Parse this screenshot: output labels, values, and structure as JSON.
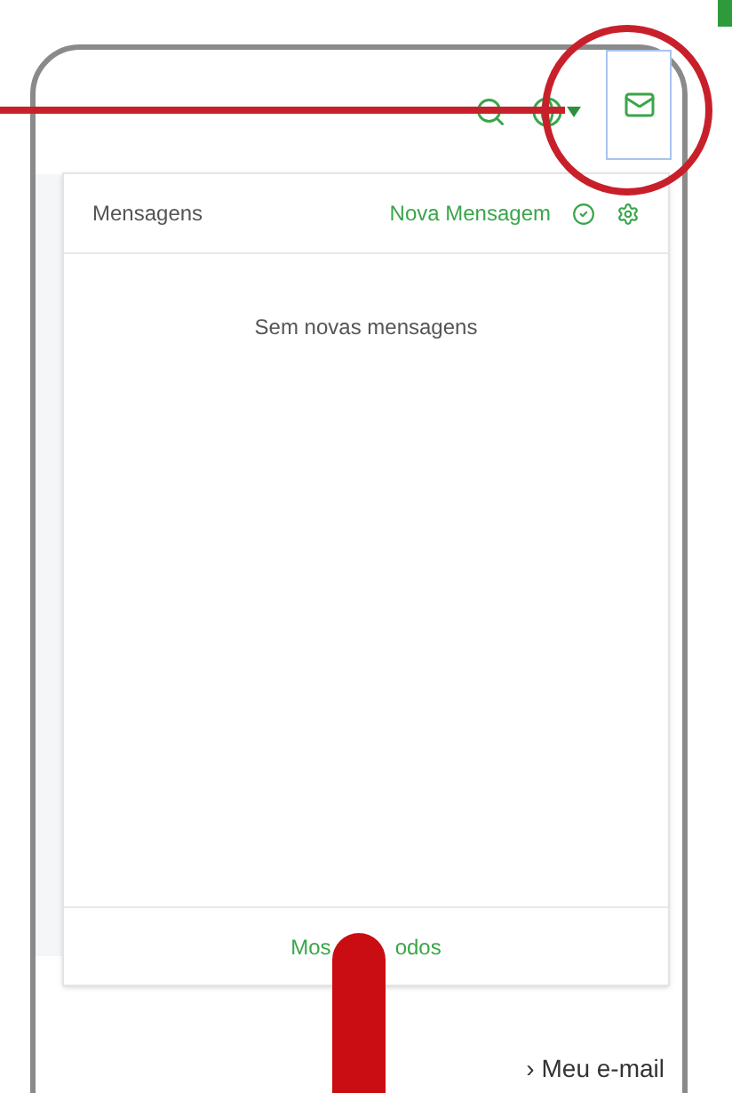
{
  "dropdown": {
    "title": "Mensagens",
    "new_message_link": "Nova Mensagem",
    "empty_text": "Sem novas mensagens",
    "footer_link_parts": [
      "Mos",
      "odos"
    ]
  },
  "background_link": {
    "arrow": "›",
    "label": "Meu e-mail"
  }
}
